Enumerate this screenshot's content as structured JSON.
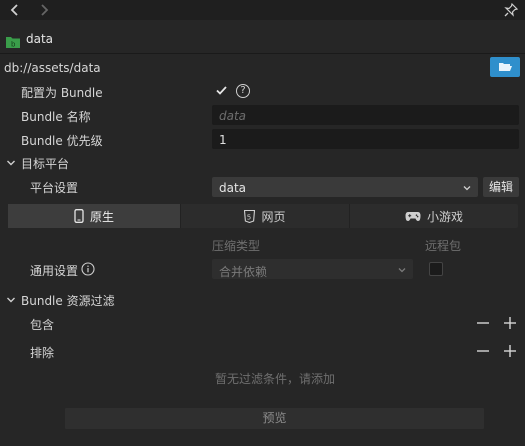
{
  "asset": {
    "name": "data",
    "url": "db://assets/data"
  },
  "props": {
    "is_bundle_label": "配置为 Bundle",
    "bundle_name_label": "Bundle 名称",
    "bundle_name_placeholder": "data",
    "bundle_priority_label": "Bundle 优先级",
    "bundle_priority_value": "1"
  },
  "target_platform": {
    "section_label": "目标平台",
    "platform_settings_label": "平台设置",
    "platform_value": "data",
    "edit_label": "编辑"
  },
  "tabs": [
    {
      "label": "原生",
      "icon": "phone-icon"
    },
    {
      "label": "网页",
      "icon": "html5-icon"
    },
    {
      "label": "小游戏",
      "icon": "gamepad-icon"
    }
  ],
  "compress": {
    "col_compress_type": "压缩类型",
    "col_remote": "远程包",
    "general_label": "通用设置",
    "compress_value": "合并依赖"
  },
  "filter": {
    "section_label": "Bundle 资源过滤",
    "include_label": "包含",
    "exclude_label": "排除",
    "empty_hint": "暂无过滤条件，请添加"
  },
  "footer": {
    "preview_label": "预览"
  },
  "colors": {
    "accent": "#2f8fcc",
    "panel": "#262626",
    "input": "#1b1b1b"
  }
}
